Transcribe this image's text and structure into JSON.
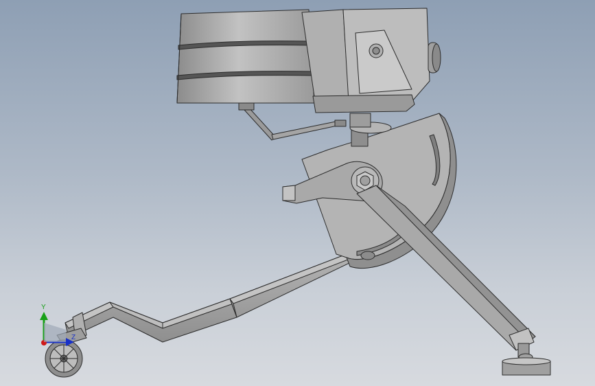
{
  "viewport": {
    "background_top": "#8e9fb4",
    "background_bottom": "#d7dadf"
  },
  "model": {
    "part_color": "#a9a9a9",
    "edge_color": "#2b2b2b"
  },
  "triad": {
    "y_label": "Y",
    "z_label": "Z",
    "x_color": "#d01818",
    "y_color": "#18a018",
    "z_color": "#1830c8"
  }
}
